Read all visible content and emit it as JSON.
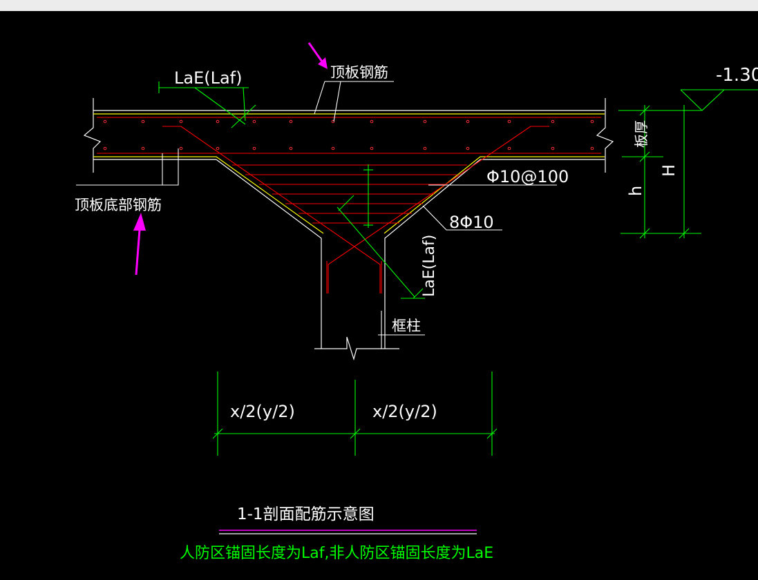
{
  "labels": {
    "lae_laf_top": "LaE(Laf)",
    "top_rebar": "顶板钢筋",
    "bottom_rebar": "顶板底部钢筋",
    "level": "-1.30",
    "slab_thickness": "板厚",
    "h_small": "h",
    "h_big": "H",
    "stirrup": "Φ10@100",
    "bars": "8Φ10",
    "lae_laf_side": "LaE(Laf)",
    "column": "框柱",
    "dim_left": "x/2(y/2)",
    "dim_right": "x/2(y/2)",
    "title": "1-1剖面配筋示意图",
    "note": "人防区锚固长度为Laf,非人防区锚固长度为LaE"
  },
  "colors": {
    "background": "#000000",
    "outline": "#ffffff",
    "rebar": "#ff0000",
    "slab_face": "#ffff00",
    "dimension": "#00ff00",
    "arrow": "#ff00ff",
    "underline": "#ff00ff"
  }
}
